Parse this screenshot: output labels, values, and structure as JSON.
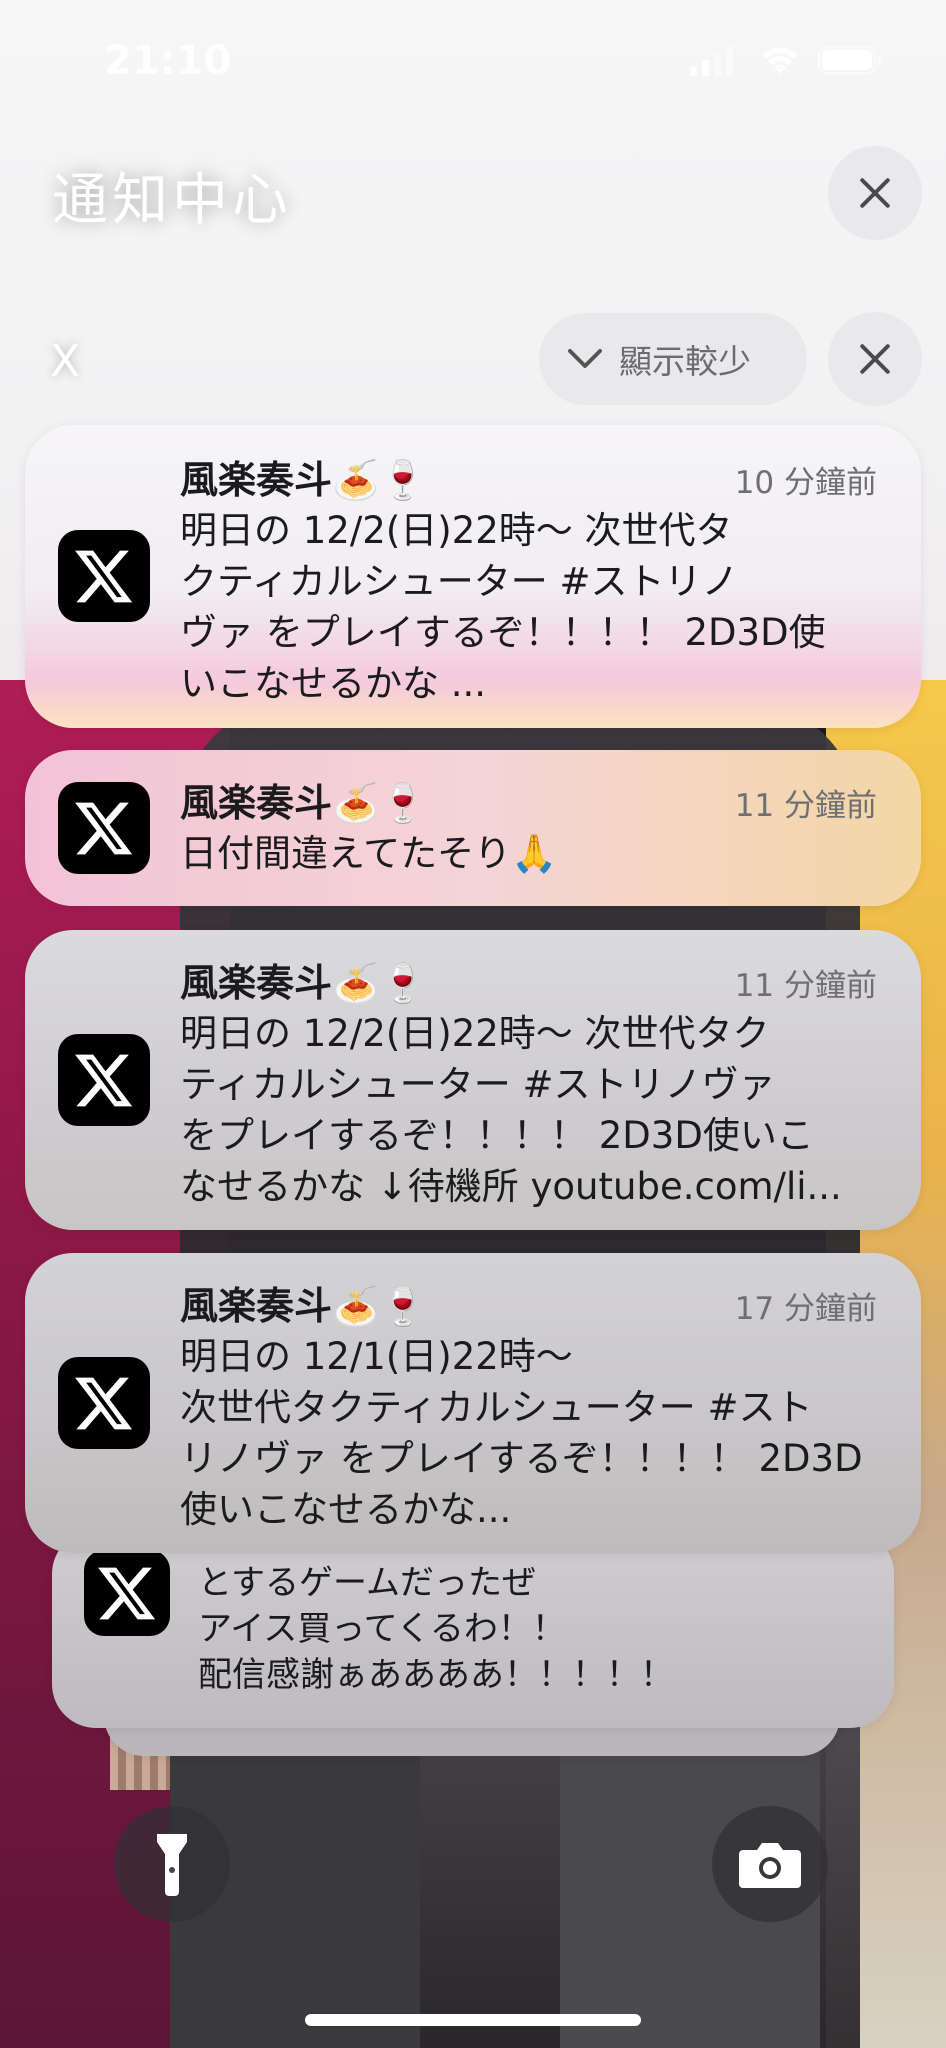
{
  "status_bar": {
    "time": "21:10"
  },
  "header": {
    "title": "通知中心"
  },
  "group": {
    "app_name": "X",
    "show_less_label": "顯示較少"
  },
  "notifications": [
    {
      "app": "X",
      "sender": "風楽奏斗🍝🍷",
      "time": "10 分鐘前",
      "lines": [
        "明日の 12/2(日)22時～ 次世代タ",
        "クティカルシューター #ストリノ",
        "ヴァ をプレイするぞ！！！！ 2D3D使",
        "いこなせるかな ..."
      ]
    },
    {
      "app": "X",
      "sender": "風楽奏斗🍝🍷",
      "time": "11 分鐘前",
      "lines": [
        "日付間違えてたそり🙏"
      ]
    },
    {
      "app": "X",
      "sender": "風楽奏斗🍝🍷",
      "time": "11 分鐘前",
      "lines": [
        "明日の 12/2(日)22時～ 次世代タク",
        "ティカルシューター #ストリノヴァ",
        "をプレイするぞ！！！！ 2D3D使いこ",
        "なせるかな ↓待機所 youtube.com/li..."
      ]
    },
    {
      "app": "X",
      "sender": "風楽奏斗🍝🍷",
      "time": "17 分鐘前",
      "lines": [
        "明日の 12/1(日)22時～",
        "次世代タクティカルシューター #スト",
        "リノヴァ をプレイするぞ！！！！ 2D3D",
        "使いこなせるかな..."
      ]
    },
    {
      "app": "X",
      "lines": [
        "とするゲームだったぜ",
        "アイス買ってくるわ！！",
        "配信感謝ぁああああ！！！！！"
      ]
    }
  ],
  "icons": {
    "app": "x-logo-icon",
    "close": "close-icon",
    "chevron": "chevron-down-icon",
    "flashlight": "flashlight-icon",
    "camera": "camera-icon"
  }
}
